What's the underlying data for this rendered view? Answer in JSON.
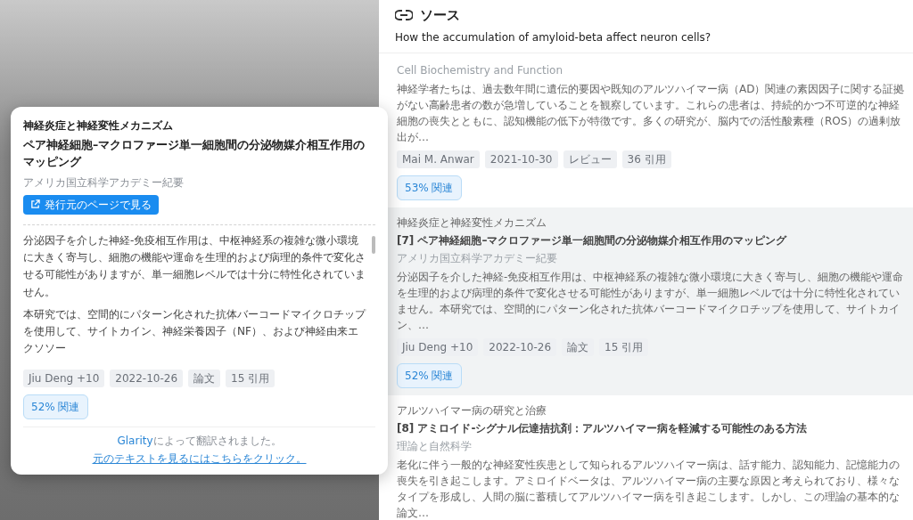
{
  "popup": {
    "topic": "神経炎症と神経変性メカニズム",
    "title": "ペア神経細胞–マクロファージ単一細胞間の分泌物媒介相互作用のマッピング",
    "journal": "アメリカ国立科学アカデミー紀要",
    "button": "発行元のページで見る",
    "paragraphs": [
      "分泌因子を介した神経-免疫相互作用は、中枢神経系の複雑な微小環境に大きく寄与し、細胞の機能や運命を生理的および病理的条件で変化させる可能性がありますが、単一細胞レベルでは十分に特性化されていません。",
      "本研究では、空間的にパターン化された抗体バーコードマイクロチップを使用して、サイトカイン、神経栄養因子（NF）、および神経由来エクソソー"
    ],
    "tags": [
      "Jiu Deng +10",
      "2022-10-26",
      "論文",
      "15 引用"
    ],
    "relevance": "52% 関連",
    "footer": {
      "brand": "Glarity",
      "note": "によって翻訳されました。",
      "link": "元のテキストを見るにはこちらをクリック。"
    }
  },
  "panel": {
    "title": "ソース",
    "question": "How the accumulation of amyloid-beta affect neuron cells?",
    "items": [
      {
        "selected": false,
        "journal": "Cell Biochemistry and Function",
        "abstract": "神経学者たちは、過去数年間に遺伝的要因や既知のアルツハイマー病（AD）関連の素因因子に関する証拠がない高齢患者の数が急増していることを観察しています。これらの患者は、持続的かつ不可逆的な神経細胞の喪失とともに、認知機能の低下が特徴です。多くの研究が、脳内での活性酸素種（ROS）の過剰放出が…",
        "tags": [
          "Mai M. Anwar",
          "2021-10-30",
          "レビュー",
          "36 引用"
        ],
        "relevance": "53% 関連"
      },
      {
        "selected": true,
        "topic": "神経炎症と神経変性メカニズム",
        "title": "[7] ペア神経細胞–マクロファージ単一細胞間の分泌物媒介相互作用のマッピング",
        "journal": "アメリカ国立科学アカデミー紀要",
        "abstract": "分泌因子を介した神経-免疫相互作用は、中枢神経系の複雑な微小環境に大きく寄与し、細胞の機能や運命を生理的および病理的条件で変化させる可能性がありますが、単一細胞レベルでは十分に特性化されていません。本研究では、空間的にパターン化された抗体バーコードマイクロチップを使用して、サイトカイン、…",
        "tags": [
          "Jiu Deng +10",
          "2022-10-26",
          "論文",
          "15 引用"
        ],
        "relevance": "52% 関連"
      },
      {
        "selected": false,
        "topic": "アルツハイマー病の研究と治療",
        "title": "[8] アミロイド-シグナル伝達拮抗剤：アルツハイマー病を軽減する可能性のある方法",
        "journal": "理論と自然科学",
        "abstract": "老化に伴う一般的な神経変性疾患として知られるアルツハイマー病は、話す能力、認知能力、記憶能力の喪失を引き起こします。アミロイドベータは、アルツハイマー病の主要な原因と考えられており、様々なタイプを形成し、人間の脳に蓄積してアルツハイマー病を引き起こします。しかし、この理論の基本的な論文…"
      }
    ]
  }
}
